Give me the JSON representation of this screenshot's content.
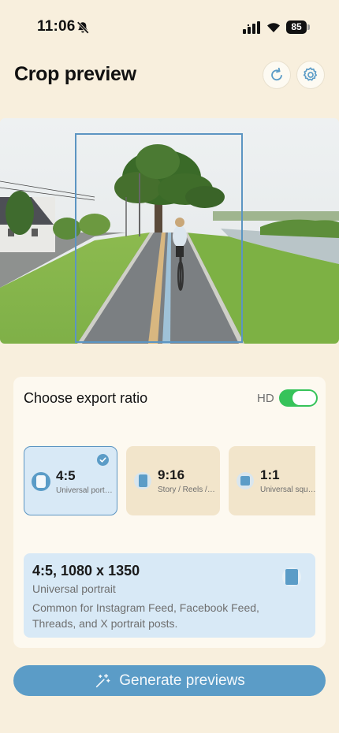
{
  "status_bar": {
    "time": "11:06",
    "battery": "85",
    "icons": [
      "bell-slash-icon",
      "signal-icon",
      "wifi-icon",
      "battery-icon"
    ]
  },
  "header": {
    "title": "Crop preview",
    "actions": [
      {
        "name": "refresh",
        "icon": "refresh-icon"
      },
      {
        "name": "settings",
        "icon": "gear-icon"
      }
    ]
  },
  "export": {
    "title": "Choose export ratio",
    "hd_label": "HD",
    "hd_enabled": true,
    "ratios": [
      {
        "name": "4:5",
        "sub": "Universal portrait",
        "selected": true
      },
      {
        "name": "9:16",
        "sub": "Story / Reels / Shorts",
        "selected": false
      },
      {
        "name": "1:1",
        "sub": "Universal square",
        "selected": false
      }
    ],
    "detail": {
      "title": "4:5, 1080 x 1350",
      "subtitle": "Universal portrait",
      "description": "Common for Instagram Feed, Facebook Feed, Threads, and X portrait posts."
    }
  },
  "generate": {
    "label": "Generate previews",
    "icon": "magic-wand-icon"
  },
  "colors": {
    "background": "#f8efdd",
    "accent": "#5b9cc7",
    "toggle_on": "#36c35a",
    "selected_card": "#d8e9f6"
  }
}
